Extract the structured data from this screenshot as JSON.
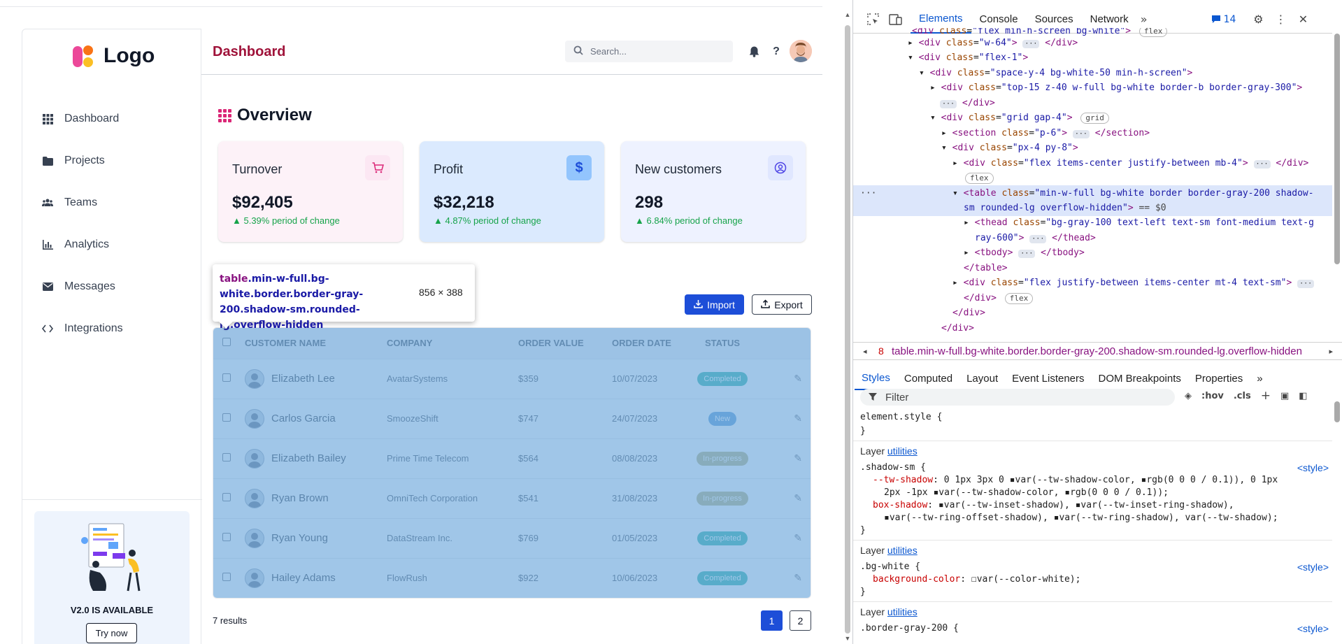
{
  "sidebar": {
    "logo_text": "Logo",
    "items": [
      {
        "label": "Dashboard",
        "icon": "grid-icon"
      },
      {
        "label": "Projects",
        "icon": "folder-icon"
      },
      {
        "label": "Teams",
        "icon": "users-icon"
      },
      {
        "label": "Analytics",
        "icon": "chart-icon"
      },
      {
        "label": "Messages",
        "icon": "envelope-icon"
      },
      {
        "label": "Integrations",
        "icon": "code-icon"
      }
    ],
    "promo": {
      "version_text": "V2.0 IS AVAILABLE",
      "button_label": "Try now"
    }
  },
  "header": {
    "title": "Dashboard",
    "search_placeholder": "Search..."
  },
  "overview": {
    "title": "Overview",
    "cards": [
      {
        "title": "Turnover",
        "value": "$92,405",
        "change": "▲ 5.39% period of change",
        "bg": "#fdf2f8",
        "icon": "cart-icon",
        "icon_bg": "#fce7f3",
        "icon_color": "#db2777"
      },
      {
        "title": "Profit",
        "value": "$32,218",
        "change": "▲ 4.87% period of change",
        "bg": "#dbeafe",
        "icon": "dollar-icon",
        "icon_bg": "#93c5fd",
        "icon_color": "#1d4ed8"
      },
      {
        "title": "New customers",
        "value": "298",
        "change": "▲ 6.84% period of change",
        "bg": "#eef2ff",
        "icon": "user-circle-icon",
        "icon_bg": "#e0e7ff",
        "icon_color": "#4f46e5"
      }
    ]
  },
  "actions": {
    "import_label": "Import",
    "export_label": "Export"
  },
  "table": {
    "columns": [
      "CUSTOMER NAME",
      "COMPANY",
      "ORDER VALUE",
      "ORDER DATE",
      "STATUS"
    ],
    "rows": [
      {
        "name": "Elizabeth Lee",
        "company": "AvatarSystems",
        "value": "$359",
        "date": "10/07/2023",
        "status": "Completed",
        "status_color": "#2db4a8"
      },
      {
        "name": "Carlos Garcia",
        "company": "SmoozeShift",
        "value": "$747",
        "date": "24/07/2023",
        "status": "New",
        "status_color": "#5b9bd5"
      },
      {
        "name": "Elizabeth Bailey",
        "company": "Prime Time Telecom",
        "value": "$564",
        "date": "08/08/2023",
        "status": "In-progress",
        "status_color": "#b8b27e"
      },
      {
        "name": "Ryan Brown",
        "company": "OmniTech Corporation",
        "value": "$541",
        "date": "31/08/2023",
        "status": "In-progress",
        "status_color": "#b8b27e"
      },
      {
        "name": "Ryan Young",
        "company": "DataStream Inc.",
        "value": "$769",
        "date": "01/05/2023",
        "status": "Completed",
        "status_color": "#2db4a8"
      },
      {
        "name": "Hailey Adams",
        "company": "FlowRush",
        "value": "$922",
        "date": "10/06/2023",
        "status": "Completed",
        "status_color": "#2db4a8"
      }
    ],
    "results_text": "7 results",
    "pages": [
      "1",
      "2"
    ],
    "current_page": "1"
  },
  "tooltip": {
    "tag": "table",
    "selector": ".min-w-full.bg-white.border.border-gray-200.shadow-sm.rounded-lg.overflow-hidden",
    "size": "856 × 388"
  },
  "devtools": {
    "tabs": [
      "Elements",
      "Console",
      "Sources",
      "Network"
    ],
    "active_tab": "Elements",
    "issues_count": "14",
    "breadcrumb": "table.min-w-full.bg-white.border.border-gray-200.shadow-sm.rounded-lg.overflow-hidden",
    "breadcrumb_num": "8",
    "sub_tabs": [
      "Styles",
      "Computed",
      "Layout",
      "Event Listeners",
      "DOM Breakpoints",
      "Properties"
    ],
    "active_sub_tab": "Styles",
    "filter_placeholder": "Filter",
    "hov": ":hov",
    "cls": ".cls"
  }
}
